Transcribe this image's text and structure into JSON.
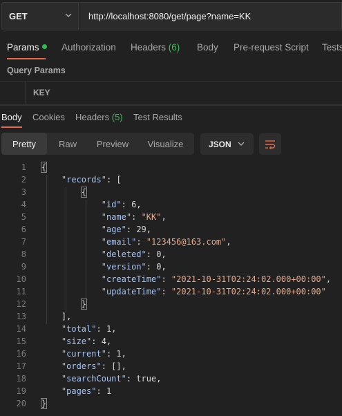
{
  "request": {
    "method": "GET",
    "url": "http://localhost:8080/get/page?name=KK"
  },
  "request_tabs": {
    "params": "Params",
    "authorization": "Authorization",
    "headers": "Headers",
    "headers_count": "(6)",
    "body": "Body",
    "prerequest": "Pre-request Script",
    "tests": "Tests"
  },
  "query_params": {
    "title": "Query Params",
    "key_header": "KEY"
  },
  "response_tabs": {
    "body": "Body",
    "cookies": "Cookies",
    "headers": "Headers",
    "headers_count": "(5)",
    "test_results": "Test Results"
  },
  "view": {
    "pretty": "Pretty",
    "raw": "Raw",
    "preview": "Preview",
    "visualize": "Visualize",
    "format": "JSON"
  },
  "code": {
    "line_numbers": [
      "1",
      "2",
      "3",
      "4",
      "5",
      "6",
      "7",
      "8",
      "9",
      "10",
      "11",
      "12",
      "13",
      "14",
      "15",
      "16",
      "17",
      "18",
      "19",
      "20"
    ],
    "records_key": "\"records\"",
    "fields": [
      {
        "key": "\"id\"",
        "value": "6",
        "string": false
      },
      {
        "key": "\"name\"",
        "value": "\"KK\"",
        "string": true
      },
      {
        "key": "\"age\"",
        "value": "29",
        "string": false
      },
      {
        "key": "\"email\"",
        "value": "\"123456@163.com\"",
        "string": true
      },
      {
        "key": "\"deleted\"",
        "value": "0",
        "string": false
      },
      {
        "key": "\"version\"",
        "value": "0",
        "string": false
      },
      {
        "key": "\"createTime\"",
        "value": "\"2021-10-31T02:24:02.000+00:00\"",
        "string": true
      },
      {
        "key": "\"updateTime\"",
        "value": "\"2021-10-31T02:24:02.000+00:00\"",
        "string": true
      }
    ],
    "tail": [
      {
        "key": "\"total\"",
        "value": "1"
      },
      {
        "key": "\"size\"",
        "value": "4"
      },
      {
        "key": "\"current\"",
        "value": "1"
      },
      {
        "key": "\"orders\"",
        "value": "[]"
      },
      {
        "key": "\"searchCount\"",
        "value": "true"
      },
      {
        "key": "\"pages\"",
        "value": "1"
      }
    ]
  },
  "colors": {
    "accent": "#e8694a",
    "green": "#3cbf58",
    "json_key": "#a0c4ff",
    "json_string": "#e8a98c"
  }
}
